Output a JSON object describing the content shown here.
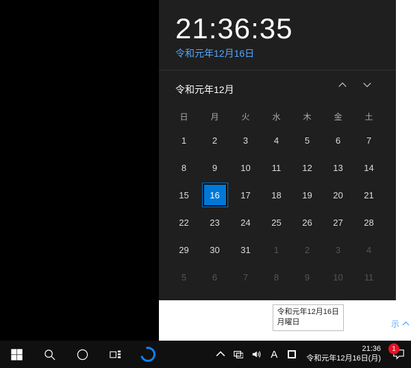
{
  "clock": {
    "time": "21:36:35",
    "date": "令和元年12月16日"
  },
  "calendar": {
    "title": "令和元年12月",
    "weekdays": [
      "日",
      "月",
      "火",
      "水",
      "木",
      "金",
      "土"
    ],
    "rows": [
      [
        {
          "n": "1"
        },
        {
          "n": "2"
        },
        {
          "n": "3"
        },
        {
          "n": "4"
        },
        {
          "n": "5"
        },
        {
          "n": "6"
        },
        {
          "n": "7"
        }
      ],
      [
        {
          "n": "8"
        },
        {
          "n": "9"
        },
        {
          "n": "10"
        },
        {
          "n": "11"
        },
        {
          "n": "12"
        },
        {
          "n": "13"
        },
        {
          "n": "14"
        }
      ],
      [
        {
          "n": "15"
        },
        {
          "n": "16",
          "today": true
        },
        {
          "n": "17"
        },
        {
          "n": "18"
        },
        {
          "n": "19"
        },
        {
          "n": "20"
        },
        {
          "n": "21"
        }
      ],
      [
        {
          "n": "22"
        },
        {
          "n": "23"
        },
        {
          "n": "24"
        },
        {
          "n": "25"
        },
        {
          "n": "26"
        },
        {
          "n": "27"
        },
        {
          "n": "28"
        }
      ],
      [
        {
          "n": "29"
        },
        {
          "n": "30"
        },
        {
          "n": "31"
        },
        {
          "n": "1",
          "other": true
        },
        {
          "n": "2",
          "other": true
        },
        {
          "n": "3",
          "other": true
        },
        {
          "n": "4",
          "other": true
        }
      ],
      [
        {
          "n": "5",
          "other": true
        },
        {
          "n": "6",
          "other": true
        },
        {
          "n": "7",
          "other": true
        },
        {
          "n": "8",
          "other": true
        },
        {
          "n": "9",
          "other": true
        },
        {
          "n": "10",
          "other": true
        },
        {
          "n": "11",
          "other": true
        }
      ]
    ]
  },
  "hide_link": "示",
  "tooltip": {
    "line1": "令和元年12月16日",
    "line2": "月曜日"
  },
  "tray": {
    "ime_mode": "A",
    "clock_time": "21:36",
    "clock_date": "令和元年12月16日(月)",
    "notification_count": "1"
  }
}
